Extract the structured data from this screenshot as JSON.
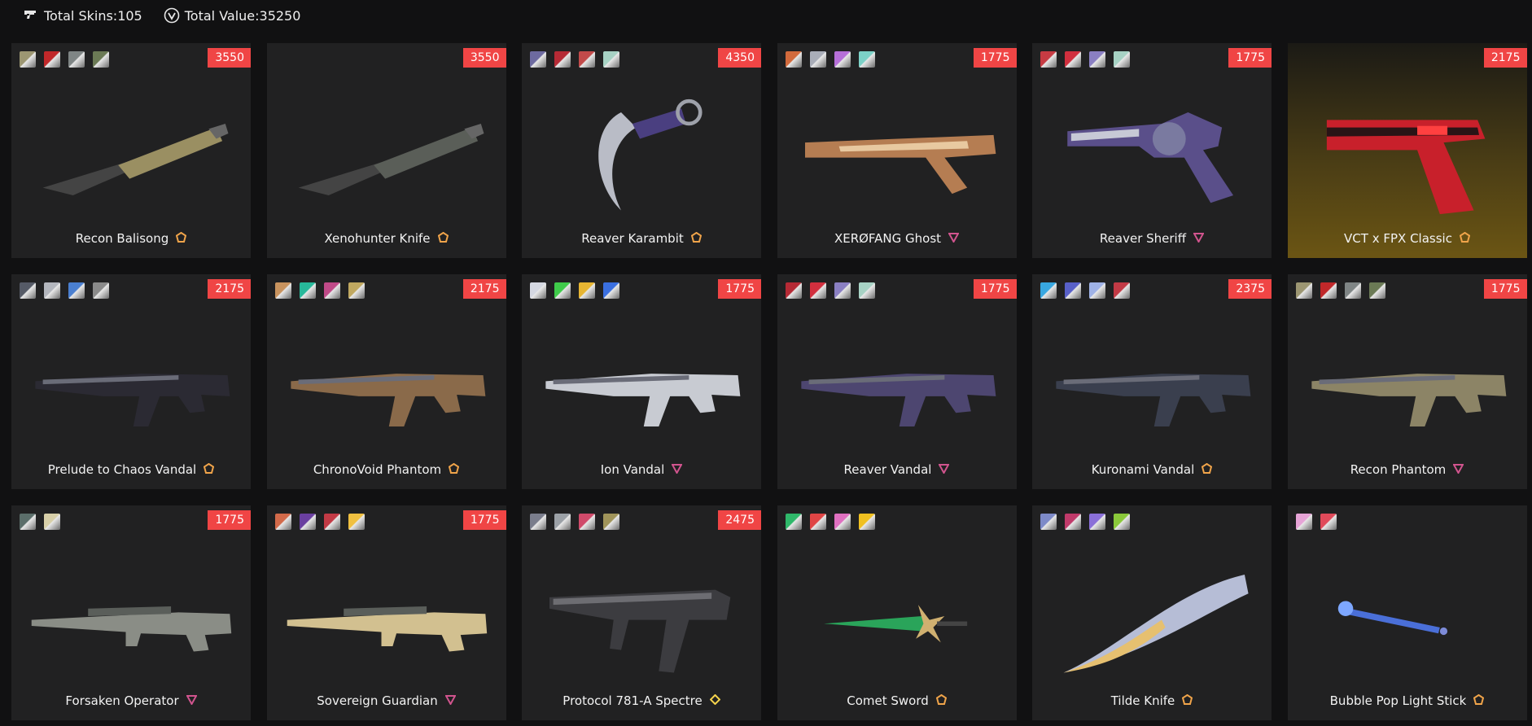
{
  "header": {
    "total_skins_label": "Total Skins:105",
    "total_value_label": "Total Value:35250",
    "skins_icon": "gun-icon",
    "value_icon": "valorant-points-icon"
  },
  "tier_colors": {
    "exclusive": "#f0a44a",
    "premium": "#d1548e",
    "ultra": "#f5d34c"
  },
  "cards": [
    {
      "name": "Recon Balisong",
      "price": "3550",
      "tier": "exclusive",
      "swatches": [
        "#9c9672",
        "#c0282a",
        "#7f8585",
        "#6b7a55"
      ],
      "shape": "knife",
      "tint": "#9a8f62"
    },
    {
      "name": "Xenohunter Knife",
      "price": "3550",
      "tier": "exclusive",
      "swatches": [],
      "shape": "knife",
      "tint": "#5a5e58"
    },
    {
      "name": "Reaver Karambit",
      "price": "4350",
      "tier": "exclusive",
      "swatches": [
        "#6d6aa0",
        "#b52a35",
        "#c24a4a",
        "#a7d2c4"
      ],
      "shape": "karambit",
      "tint": "#4a3f80"
    },
    {
      "name": "XERØFANG Ghost",
      "price": "1775",
      "tier": "premium",
      "swatches": [
        "#d26a3c",
        "#a9adb8",
        "#b66fd8",
        "#7cd1c7"
      ],
      "shape": "pistol-long",
      "tint": "#b57d52"
    },
    {
      "name": "Reaver Sheriff",
      "price": "1775",
      "tier": "premium",
      "swatches": [
        "#c73b43",
        "#d12f3e",
        "#8a7fc2",
        "#a7d2c4"
      ],
      "shape": "revolver",
      "tint": "#5a4f8a"
    },
    {
      "name": "VCT x FPX Classic",
      "price": "2175",
      "tier": "exclusive",
      "swatches": [],
      "shape": "pistol",
      "tint": "#c8202b",
      "gold": true
    },
    {
      "name": "Prelude to Chaos Vandal",
      "price": "2175",
      "tier": "exclusive",
      "swatches": [
        "#555a66",
        "#b3b6bd",
        "#4a7fd0",
        "#8a8a8a"
      ],
      "shape": "rifle",
      "tint": "#2b2a33"
    },
    {
      "name": "ChronoVoid Phantom",
      "price": "2175",
      "tier": "exclusive",
      "swatches": [
        "#c8935e",
        "#27b89a",
        "#c04a88",
        "#c0a860"
      ],
      "shape": "rifle",
      "tint": "#8a6a4a"
    },
    {
      "name": "Ion Vandal",
      "price": "1775",
      "tier": "premium",
      "swatches": [
        "#d5d8e2",
        "#3fcb4a",
        "#e7b532",
        "#3a6fe0"
      ],
      "shape": "rifle",
      "tint": "#c8cbd2"
    },
    {
      "name": "Reaver Vandal",
      "price": "1775",
      "tier": "premium",
      "swatches": [
        "#b52a35",
        "#d12f3e",
        "#8a7fc2",
        "#a7d2c4"
      ],
      "shape": "rifle",
      "tint": "#4d4670"
    },
    {
      "name": "Kuronami Vandal",
      "price": "2375",
      "tier": "exclusive",
      "swatches": [
        "#38a7e0",
        "#5860c8",
        "#9fb2e6",
        "#c23a45"
      ],
      "shape": "rifle",
      "tint": "#3a3f4e"
    },
    {
      "name": "Recon Phantom",
      "price": "1775",
      "tier": "premium",
      "swatches": [
        "#9c9672",
        "#c0282a",
        "#7f8585",
        "#6b7a55"
      ],
      "shape": "rifle",
      "tint": "#8c8466"
    },
    {
      "name": "Forsaken Operator",
      "price": "1775",
      "tier": "premium",
      "swatches": [
        "#5b6e6a",
        "#d7cfa8"
      ],
      "shape": "sniper",
      "tint": "#8a8d86"
    },
    {
      "name": "Sovereign Guardian",
      "price": "1775",
      "tier": "premium",
      "swatches": [
        "#d26a4a",
        "#6a3fa0",
        "#c23a45",
        "#f0c040"
      ],
      "shape": "sniper",
      "tint": "#d2c090"
    },
    {
      "name": "Protocol 781-A Spectre",
      "price": "2475",
      "tier": "ultra",
      "swatches": [
        "#7a7d8c",
        "#9ba0a6",
        "#d04a6a",
        "#a0945a"
      ],
      "shape": "smg",
      "tint": "#3c3c40"
    },
    {
      "name": "Comet Sword",
      "price": "",
      "tier": "exclusive",
      "swatches": [
        "#2fb86a",
        "#e04545",
        "#e070c0",
        "#f0c020"
      ],
      "shape": "sword",
      "tint": "#2aa45a"
    },
    {
      "name": "Tilde Knife",
      "price": "",
      "tier": "exclusive",
      "swatches": [
        "#7d8ac8",
        "#c03a6a",
        "#8a6fd8",
        "#8ac83a"
      ],
      "shape": "blade",
      "tint": "#b6bdd6"
    },
    {
      "name": "Bubble Pop Light Stick",
      "price": "",
      "tier": "exclusive",
      "swatches": [
        "#e6a4d6",
        "#e04a5a"
      ],
      "shape": "stick",
      "tint": "#4a6fd8"
    }
  ]
}
